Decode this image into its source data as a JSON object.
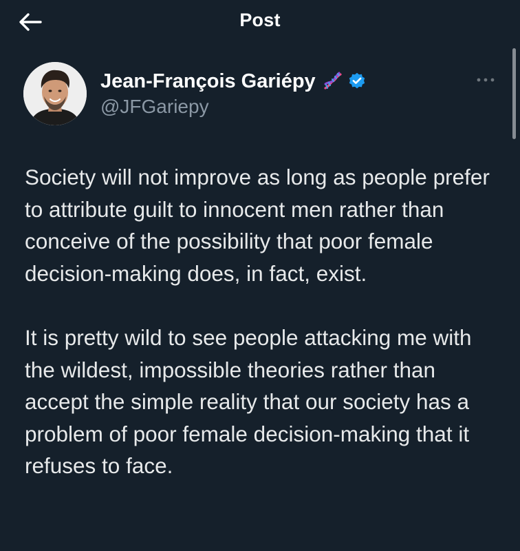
{
  "header": {
    "title": "Post",
    "back_icon": "arrow-left-icon"
  },
  "author": {
    "display_name": "Jean-François Gariépy",
    "handle": "@JFGariepy",
    "badge_icons": [
      "dna-icon",
      "verified-badge-icon"
    ],
    "verified_color": "#1d9bf0"
  },
  "menu": {
    "icon": "more-horizontal-icon"
  },
  "tweet": {
    "paragraphs": [
      "Society will not improve as long as people prefer to attribute guilt to innocent men rather than conceive of the possibility that poor female decision-making does, in fact, exist.",
      "It is pretty wild to see people attacking me with the wildest, impossible theories rather than accept the simple reality that our society has a problem of poor female decision-making that it refuses to face."
    ]
  },
  "theme": {
    "background": "#15202b",
    "text": "#e7e9ea",
    "secondary_text": "#8b98a5"
  }
}
